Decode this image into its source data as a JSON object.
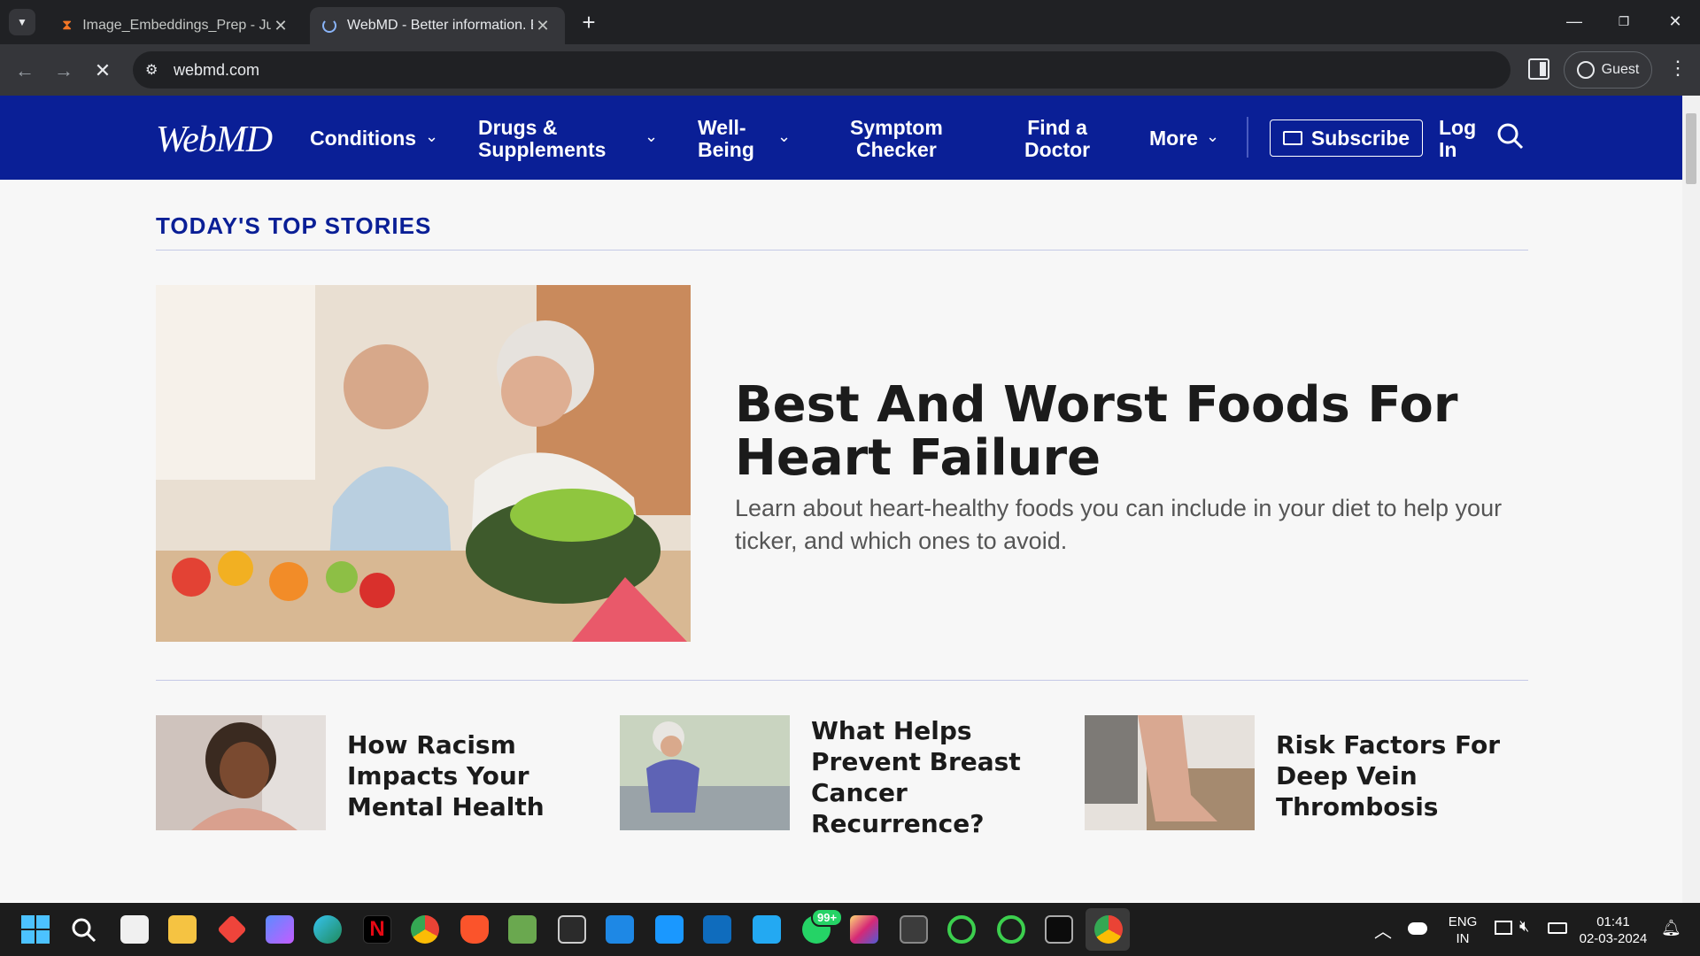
{
  "browser": {
    "tabs": [
      {
        "title": "Image_Embeddings_Prep - Jupyter",
        "active": false
      },
      {
        "title": "WebMD - Better information. Better health.",
        "active": true
      }
    ],
    "new_tab_symbol": "+",
    "url": "webmd.com",
    "profile_label": "Guest"
  },
  "site": {
    "logo_text": "WebMD",
    "nav": {
      "conditions": "Conditions",
      "drugs_line1": "Drugs &",
      "drugs_line2": "Supplements",
      "wellbeing_line1": "Well-",
      "wellbeing_line2": "Being",
      "symptom_line1": "Symptom",
      "symptom_line2": "Checker",
      "doctor_line1": "Find a",
      "doctor_line2": "Doctor",
      "more": "More",
      "subscribe": "Subscribe",
      "login_line1": "Log",
      "login_line2": "In"
    },
    "colors": {
      "header_bg": "#0a1f96",
      "title_blue": "#0a1f96"
    }
  },
  "content": {
    "section_title": "TODAY'S TOP STORIES",
    "hero": {
      "title": "Best And Worst Foods For Heart Failure",
      "description": "Learn about heart-healthy foods you can include in your diet to help your ticker, and which ones to avoid."
    },
    "stories": [
      {
        "title": "How Racism Impacts Your Mental Health"
      },
      {
        "title": "What Helps Prevent Breast Cancer Recurrence?"
      },
      {
        "title": "Risk Factors For Deep Vein Thrombosis"
      }
    ]
  },
  "taskbar": {
    "whatsapp_badge": "99+",
    "lang_line1": "ENG",
    "lang_line2": "IN",
    "time": "01:41",
    "date": "02-03-2024"
  }
}
